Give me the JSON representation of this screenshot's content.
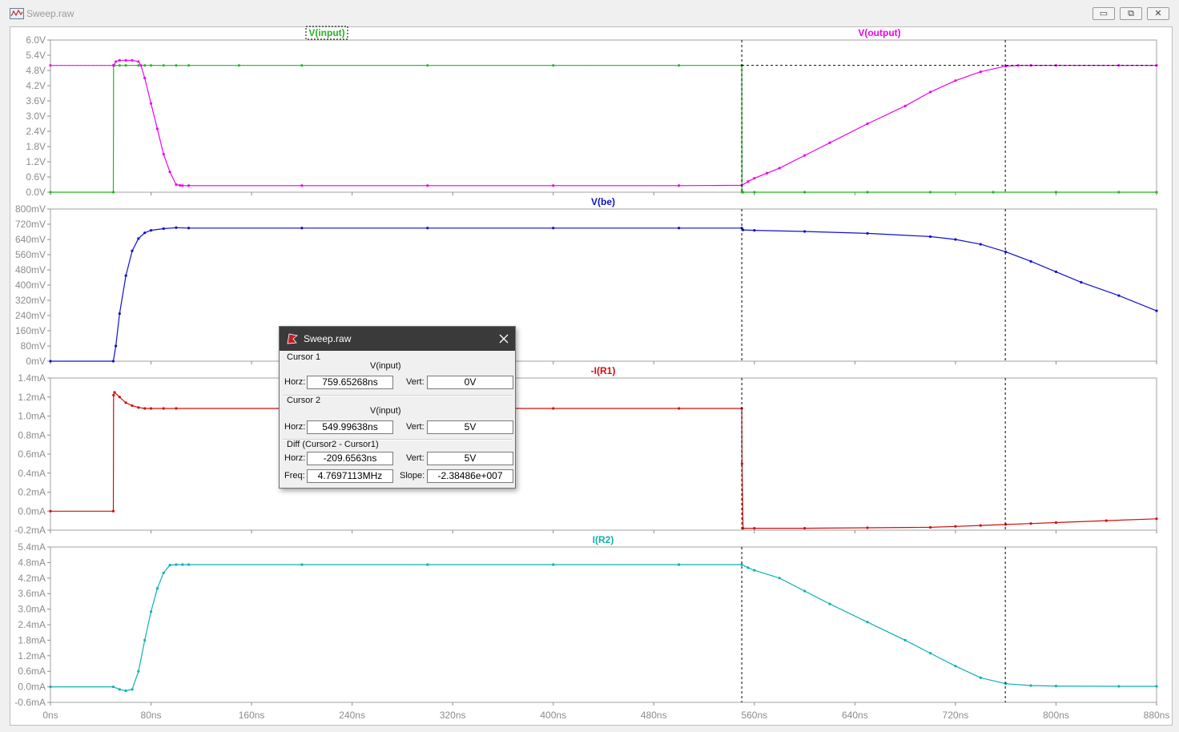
{
  "window": {
    "title": "Sweep.raw",
    "minimize_symbol": "▭",
    "maximize_symbol": "⧉",
    "close_symbol": "✕"
  },
  "x_axis": {
    "ticks": [
      "0ns",
      "80ns",
      "160ns",
      "240ns",
      "320ns",
      "400ns",
      "480ns",
      "560ns",
      "640ns",
      "720ns",
      "800ns",
      "880ns"
    ],
    "range": [
      0,
      880
    ],
    "unit": "ns"
  },
  "cursors": {
    "cursor1_x_ns": 759.65268,
    "cursor2_x_ns": 549.99638,
    "cursor1_y": 5
  },
  "colors": {
    "input": "#22b822",
    "output": "#ee00ee",
    "vbe": "#1010d0",
    "ir1": "#d01010",
    "ir2": "#10b0b0",
    "grid": "#a0a0a0",
    "cursor": "#000000"
  },
  "panes": [
    {
      "id": "v-out",
      "ticks": [
        "6.0V",
        "5.4V",
        "4.8V",
        "4.2V",
        "3.6V",
        "3.0V",
        "2.4V",
        "1.8V",
        "1.2V",
        "0.6V",
        "0.0V"
      ],
      "titles": [
        {
          "text": "V(input)",
          "color": "#22b822",
          "boxed": true
        },
        {
          "text": "V(output)",
          "color": "#ee00ee",
          "boxed": false
        }
      ]
    },
    {
      "id": "vbe",
      "ticks": [
        "800mV",
        "720mV",
        "640mV",
        "560mV",
        "480mV",
        "400mV",
        "320mV",
        "240mV",
        "160mV",
        "80mV",
        "0mV"
      ],
      "titles": [
        {
          "text": "V(be)",
          "color": "#1010d0",
          "boxed": false
        }
      ]
    },
    {
      "id": "ir1",
      "ticks": [
        "1.4mA",
        "1.2mA",
        "1.0mA",
        "0.8mA",
        "0.6mA",
        "0.4mA",
        "0.2mA",
        "0.0mA",
        "-0.2mA"
      ],
      "titles": [
        {
          "text": "-I(R1)",
          "color": "#d01010",
          "boxed": false
        }
      ]
    },
    {
      "id": "ir2",
      "ticks": [
        "5.4mA",
        "4.8mA",
        "4.2mA",
        "3.6mA",
        "3.0mA",
        "2.4mA",
        "1.8mA",
        "1.2mA",
        "0.6mA",
        "0.0mA",
        "-0.6mA"
      ],
      "titles": [
        {
          "text": "I(R2)",
          "color": "#10b0b0",
          "boxed": false
        }
      ]
    }
  ],
  "chart_data": [
    {
      "type": "line",
      "title": "",
      "x_unit": "ns",
      "xlim": [
        0,
        880
      ],
      "ylim": [
        0,
        6.0
      ],
      "y_unit": "V",
      "series": [
        {
          "name": "V(input)",
          "color": "#22b822",
          "x": [
            0,
            50,
            50.2,
            51,
            55,
            60,
            70,
            75,
            80,
            90,
            100,
            110,
            150,
            200,
            300,
            400,
            500,
            550,
            550.2,
            551,
            560,
            600,
            650,
            700,
            750,
            800,
            850,
            880
          ],
          "y": [
            0,
            0,
            5,
            5,
            5,
            5,
            5,
            5,
            5,
            5,
            5,
            5,
            5,
            5,
            5,
            5,
            5,
            5,
            0,
            0,
            0,
            0,
            0,
            0,
            0,
            0,
            0,
            0
          ]
        },
        {
          "name": "V(output)",
          "color": "#ee00ee",
          "x": [
            0,
            50,
            52,
            55,
            60,
            65,
            70,
            72,
            75,
            80,
            85,
            90,
            95,
            100,
            103,
            105,
            110,
            200,
            300,
            400,
            500,
            550,
            555,
            560,
            570,
            580,
            600,
            620,
            650,
            680,
            700,
            720,
            740,
            760,
            770,
            780,
            800,
            850,
            880
          ],
          "y": [
            5.0,
            5.0,
            5.15,
            5.2,
            5.2,
            5.2,
            5.15,
            5.0,
            4.5,
            3.5,
            2.5,
            1.5,
            0.8,
            0.3,
            0.27,
            0.26,
            0.26,
            0.26,
            0.26,
            0.26,
            0.26,
            0.27,
            0.42,
            0.55,
            0.75,
            0.95,
            1.45,
            1.95,
            2.7,
            3.4,
            3.95,
            4.4,
            4.75,
            4.97,
            5.0,
            5.0,
            5.0,
            5.0,
            5.0
          ]
        }
      ]
    },
    {
      "type": "line",
      "title": "",
      "x_unit": "ns",
      "xlim": [
        0,
        880
      ],
      "ylim": [
        0,
        800
      ],
      "y_unit": "mV",
      "series": [
        {
          "name": "V(be)",
          "color": "#1010d0",
          "x": [
            0,
            50,
            52,
            55,
            60,
            65,
            70,
            75,
            80,
            90,
            100,
            110,
            200,
            300,
            400,
            500,
            550,
            551,
            560,
            600,
            650,
            700,
            720,
            740,
            760,
            780,
            800,
            820,
            850,
            880
          ],
          "y": [
            0,
            0,
            80,
            250,
            450,
            580,
            645,
            675,
            688,
            697,
            702,
            700,
            700,
            700,
            700,
            700,
            700,
            690,
            688,
            682,
            672,
            655,
            640,
            615,
            575,
            525,
            470,
            415,
            345,
            265
          ]
        }
      ]
    },
    {
      "type": "line",
      "title": "",
      "x_unit": "ns",
      "xlim": [
        0,
        880
      ],
      "ylim": [
        -0.2,
        1.4
      ],
      "y_unit": "mA",
      "series": [
        {
          "name": "-I(R1)",
          "color": "#d01010",
          "x": [
            0,
            50,
            50.2,
            51,
            55,
            60,
            65,
            70,
            75,
            80,
            90,
            100,
            200,
            300,
            400,
            500,
            550,
            550.2,
            551,
            560,
            600,
            650,
            700,
            720,
            740,
            760,
            780,
            800,
            840,
            880
          ],
          "y": [
            0,
            0,
            1.22,
            1.25,
            1.2,
            1.14,
            1.11,
            1.09,
            1.08,
            1.08,
            1.08,
            1.08,
            1.08,
            1.08,
            1.08,
            1.08,
            1.08,
            0.5,
            -0.18,
            -0.18,
            -0.18,
            -0.175,
            -0.17,
            -0.16,
            -0.15,
            -0.14,
            -0.13,
            -0.12,
            -0.1,
            -0.08
          ]
        }
      ]
    },
    {
      "type": "line",
      "title": "",
      "x_unit": "ns",
      "xlim": [
        0,
        880
      ],
      "ylim": [
        -0.6,
        5.4
      ],
      "y_unit": "mA",
      "series": [
        {
          "name": "I(R2)",
          "color": "#10b0b0",
          "x": [
            0,
            50,
            55,
            60,
            65,
            70,
            75,
            80,
            85,
            90,
            95,
            100,
            105,
            110,
            200,
            300,
            400,
            500,
            550,
            555,
            560,
            580,
            600,
            620,
            650,
            680,
            700,
            720,
            740,
            760,
            780,
            800,
            850,
            880
          ],
          "y": [
            0,
            0,
            -0.1,
            -0.15,
            -0.1,
            0.6,
            1.8,
            2.9,
            3.8,
            4.4,
            4.7,
            4.72,
            4.72,
            4.72,
            4.72,
            4.72,
            4.72,
            4.72,
            4.72,
            4.6,
            4.5,
            4.2,
            3.7,
            3.2,
            2.5,
            1.8,
            1.3,
            0.8,
            0.35,
            0.12,
            0.05,
            0.03,
            0.02,
            0.02
          ]
        }
      ]
    }
  ],
  "dialog": {
    "title": "Sweep.raw",
    "close_symbol": "✕",
    "cursor1": {
      "group": "Cursor 1",
      "trace": "V(input)",
      "horz_label": "Horz:",
      "horz": "759.65268ns",
      "vert_label": "Vert:",
      "vert": "0V"
    },
    "cursor2": {
      "group": "Cursor 2",
      "trace": "V(input)",
      "horz_label": "Horz:",
      "horz": "549.99638ns",
      "vert_label": "Vert:",
      "vert": "5V"
    },
    "diff": {
      "group": "Diff (Cursor2 - Cursor1)",
      "horz_label": "Horz:",
      "horz": "-209.6563ns",
      "vert_label": "Vert:",
      "vert": "5V",
      "freq_label": "Freq:",
      "freq": "4.7697113MHz",
      "slope_label": "Slope:",
      "slope": "-2.38486e+007"
    }
  }
}
